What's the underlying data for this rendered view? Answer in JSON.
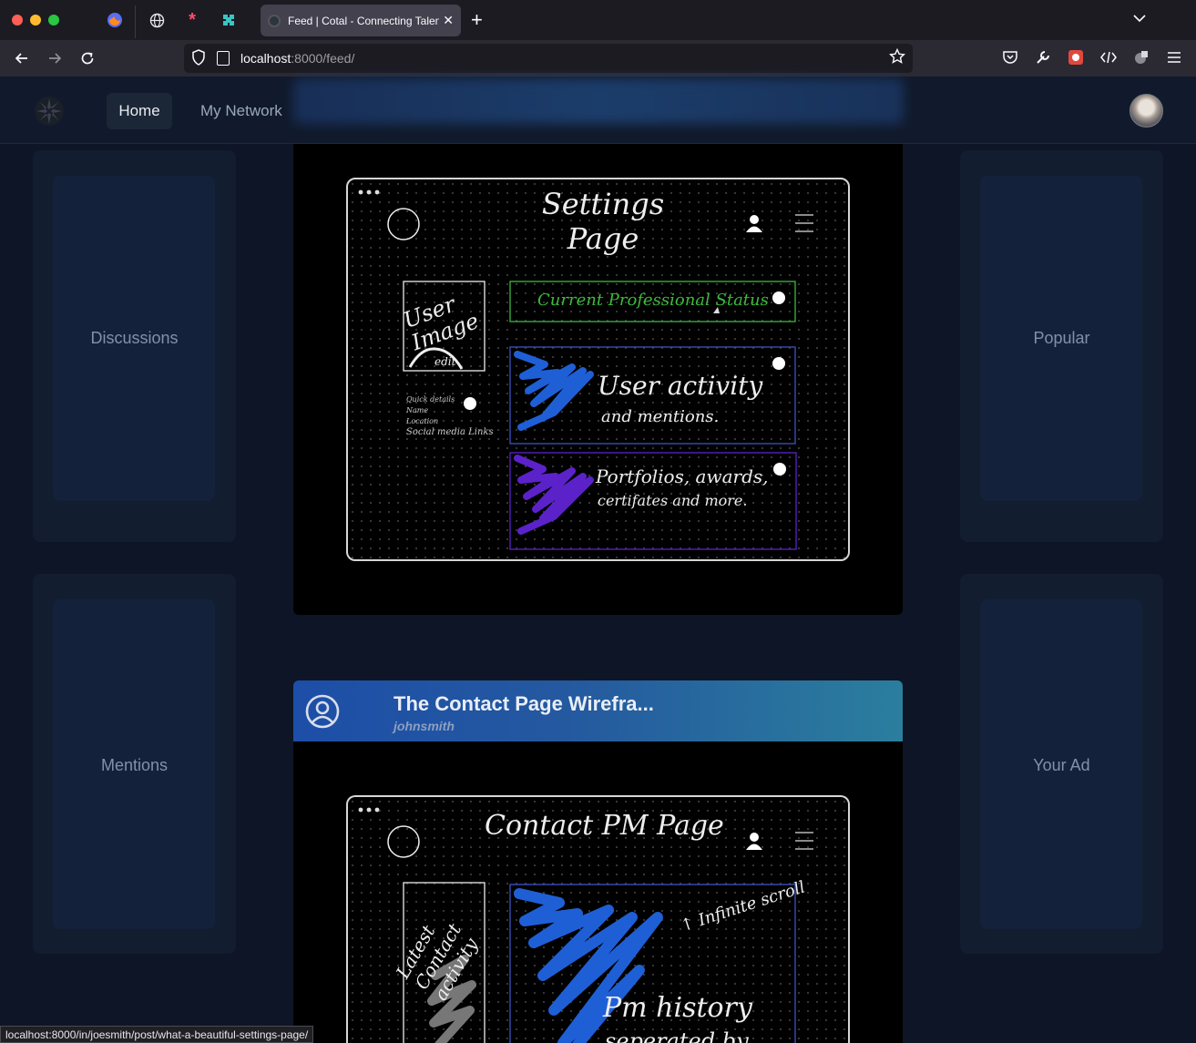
{
  "browser": {
    "tab_title": "Feed | Cotal - Connecting Talent",
    "tab_close": "✕",
    "new_tab": "+",
    "url_host": "localhost",
    "url_path": ":8000/feed/",
    "status_url": "localhost:8000/in/joesmith/post/what-a-beautiful-settings-page/"
  },
  "nav": {
    "home": "Home",
    "network": "My Network"
  },
  "left_sidebar": {
    "panel1": "Discussions",
    "panel2": "Mentions"
  },
  "right_sidebar": {
    "panel1": "Popular",
    "panel2": "Your Ad"
  },
  "posts": [
    {
      "wireframe": {
        "title": "Settings Page",
        "image_box": "User Image",
        "image_edit": "edit",
        "quick_details": [
          "Quick details",
          "Name",
          "Location",
          "Social media Links"
        ],
        "status_box": "Current Professional Status",
        "activity_line1": "User activity",
        "activity_line2": "and mentions.",
        "portfolio_line1": "Portfolios, awards,",
        "portfolio_line2": "certifates and more."
      }
    },
    {
      "title": "The Contact Page Wirefra...",
      "author": "johnsmith",
      "wireframe": {
        "title": "Contact PM Page",
        "left_box": "Latest Contact activity",
        "scroll_note": "↑ Infinite scroll",
        "history_line1": "Pm history",
        "history_line2": "seperated by"
      }
    }
  ],
  "colors": {
    "page_bg": "#0d1526",
    "status_green": "#3cba3c",
    "blue_scribble": "#1f5fd6",
    "purple_scribble": "#5b22c9"
  }
}
